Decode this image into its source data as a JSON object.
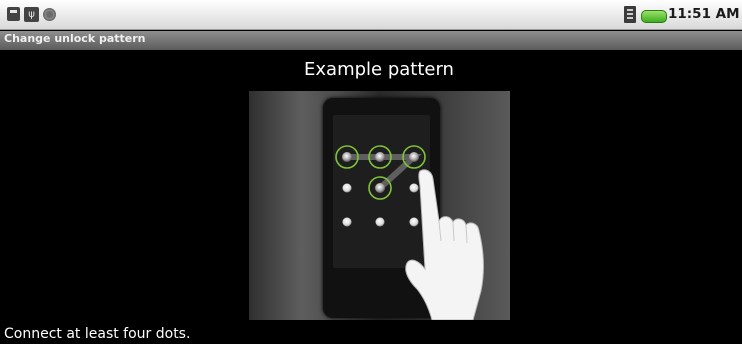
{
  "status_bar": {
    "time": "11:51 AM",
    "icons": [
      "sd-card-icon",
      "usb-debugging-icon",
      "notification-dot-icon",
      "sim-signal-icon",
      "battery-icon"
    ],
    "battery_color": "#3fae1f"
  },
  "title_bar": {
    "title": "Change unlock pattern"
  },
  "main": {
    "heading": "Example pattern",
    "illustration": {
      "icons": [
        "phone-illustration",
        "pattern-grid-icon",
        "pointing-hand-icon"
      ],
      "highlight_color": "#7ec43a"
    },
    "instructions": "Connect at least four dots."
  }
}
